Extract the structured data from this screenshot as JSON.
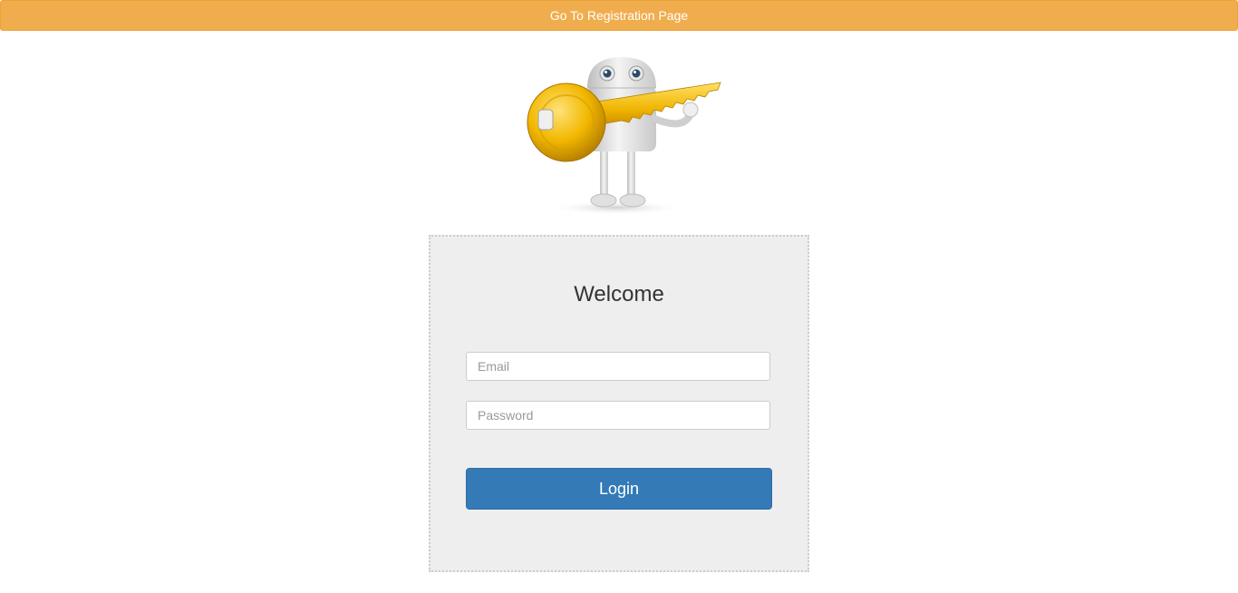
{
  "topbar": {
    "label": "Go To Registration Page",
    "color": "#f0ad4e"
  },
  "mascot": {
    "icon": "robot-holding-key-icon"
  },
  "login_form": {
    "title": "Welcome",
    "email_placeholder": "Email",
    "email_value": "",
    "password_placeholder": "Password",
    "password_value": "",
    "login_label": "Login",
    "login_color": "#337ab7"
  }
}
